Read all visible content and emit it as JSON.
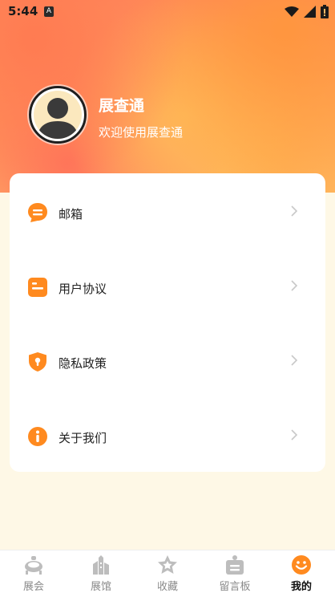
{
  "status_bar": {
    "time": "5:44",
    "notif_letter": "A"
  },
  "profile": {
    "name": "展查通",
    "subtitle": "欢迎使用展查通"
  },
  "menu": [
    {
      "label": "邮箱",
      "icon": "mailbox-icon"
    },
    {
      "label": "用户协议",
      "icon": "user-agreement-icon"
    },
    {
      "label": "隐私政策",
      "icon": "privacy-shield-icon"
    },
    {
      "label": "关于我们",
      "icon": "info-icon"
    }
  ],
  "tabs": [
    {
      "label": "展会",
      "icon": "exhibition-icon",
      "active": false
    },
    {
      "label": "展馆",
      "icon": "venue-building-icon",
      "active": false
    },
    {
      "label": "收藏",
      "icon": "favorite-star-icon",
      "active": false
    },
    {
      "label": "留言板",
      "icon": "message-board-icon",
      "active": false
    },
    {
      "label": "我的",
      "icon": "smiley-profile-icon",
      "active": true
    }
  ],
  "colors": {
    "accent": "#FF8A1F",
    "page_bg": "#FEF8E6",
    "inactive_tab": "#8a8a8a"
  }
}
